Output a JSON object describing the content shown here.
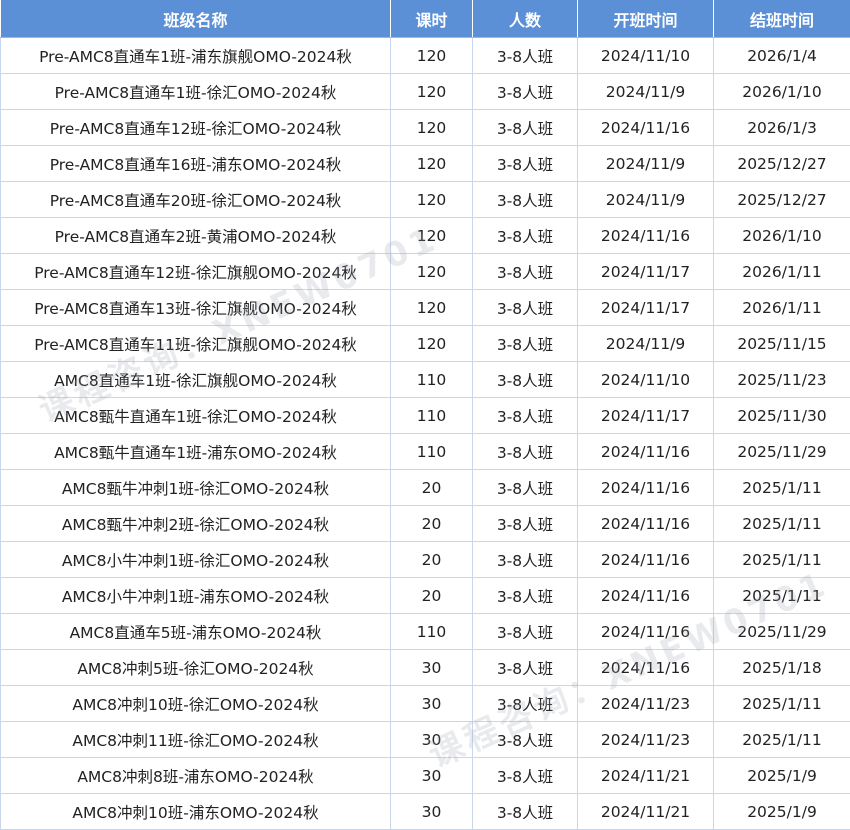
{
  "table": {
    "headers": [
      "班级名称",
      "课时",
      "人数",
      "开班时间",
      "结班时间"
    ],
    "rows": [
      [
        "Pre-AMC8直通车1班-浦东旗舰OMO-2024秋",
        "120",
        "3-8人班",
        "2024/11/10",
        "2026/1/4"
      ],
      [
        "Pre-AMC8直通车1班-徐汇OMO-2024秋",
        "120",
        "3-8人班",
        "2024/11/9",
        "2026/1/10"
      ],
      [
        "Pre-AMC8直通车12班-徐汇OMO-2024秋",
        "120",
        "3-8人班",
        "2024/11/16",
        "2026/1/3"
      ],
      [
        "Pre-AMC8直通车16班-浦东OMO-2024秋",
        "120",
        "3-8人班",
        "2024/11/9",
        "2025/12/27"
      ],
      [
        "Pre-AMC8直通车20班-徐汇OMO-2024秋",
        "120",
        "3-8人班",
        "2024/11/9",
        "2025/12/27"
      ],
      [
        "Pre-AMC8直通车2班-黄浦OMO-2024秋",
        "120",
        "3-8人班",
        "2024/11/16",
        "2026/1/10"
      ],
      [
        "Pre-AMC8直通车12班-徐汇旗舰OMO-2024秋",
        "120",
        "3-8人班",
        "2024/11/17",
        "2026/1/11"
      ],
      [
        "Pre-AMC8直通车13班-徐汇旗舰OMO-2024秋",
        "120",
        "3-8人班",
        "2024/11/17",
        "2026/1/11"
      ],
      [
        "Pre-AMC8直通车11班-徐汇旗舰OMO-2024秋",
        "120",
        "3-8人班",
        "2024/11/9",
        "2025/11/15"
      ],
      [
        "AMC8直通车1班-徐汇旗舰OMO-2024秋",
        "110",
        "3-8人班",
        "2024/11/10",
        "2025/11/23"
      ],
      [
        "AMC8甄牛直通车1班-徐汇OMO-2024秋",
        "110",
        "3-8人班",
        "2024/11/17",
        "2025/11/30"
      ],
      [
        "AMC8甄牛直通车1班-浦东OMO-2024秋",
        "110",
        "3-8人班",
        "2024/11/16",
        "2025/11/29"
      ],
      [
        "AMC8甄牛冲刺1班-徐汇OMO-2024秋",
        "20",
        "3-8人班",
        "2024/11/16",
        "2025/1/11"
      ],
      [
        "AMC8甄牛冲刺2班-徐汇OMO-2024秋",
        "20",
        "3-8人班",
        "2024/11/16",
        "2025/1/11"
      ],
      [
        "AMC8小牛冲刺1班-徐汇OMO-2024秋",
        "20",
        "3-8人班",
        "2024/11/16",
        "2025/1/11"
      ],
      [
        "AMC8小牛冲刺1班-浦东OMO-2024秋",
        "20",
        "3-8人班",
        "2024/11/16",
        "2025/1/11"
      ],
      [
        "AMC8直通车5班-浦东OMO-2024秋",
        "110",
        "3-8人班",
        "2024/11/16",
        "2025/11/29"
      ],
      [
        "AMC8冲刺5班-徐汇OMO-2024秋",
        "30",
        "3-8人班",
        "2024/11/16",
        "2025/1/18"
      ],
      [
        "AMC8冲刺10班-徐汇OMO-2024秋",
        "30",
        "3-8人班",
        "2024/11/23",
        "2025/1/11"
      ],
      [
        "AMC8冲刺11班-徐汇OMO-2024秋",
        "30",
        "3-8人班",
        "2024/11/23",
        "2025/1/11"
      ],
      [
        "AMC8冲刺8班-浦东OMO-2024秋",
        "30",
        "3-8人班",
        "2024/11/21",
        "2025/1/9"
      ],
      [
        "AMC8冲刺10班-浦东OMO-2024秋",
        "30",
        "3-8人班",
        "2024/11/21",
        "2025/1/9"
      ]
    ]
  },
  "watermark": {
    "text": "课程咨询：XNEW0701"
  }
}
